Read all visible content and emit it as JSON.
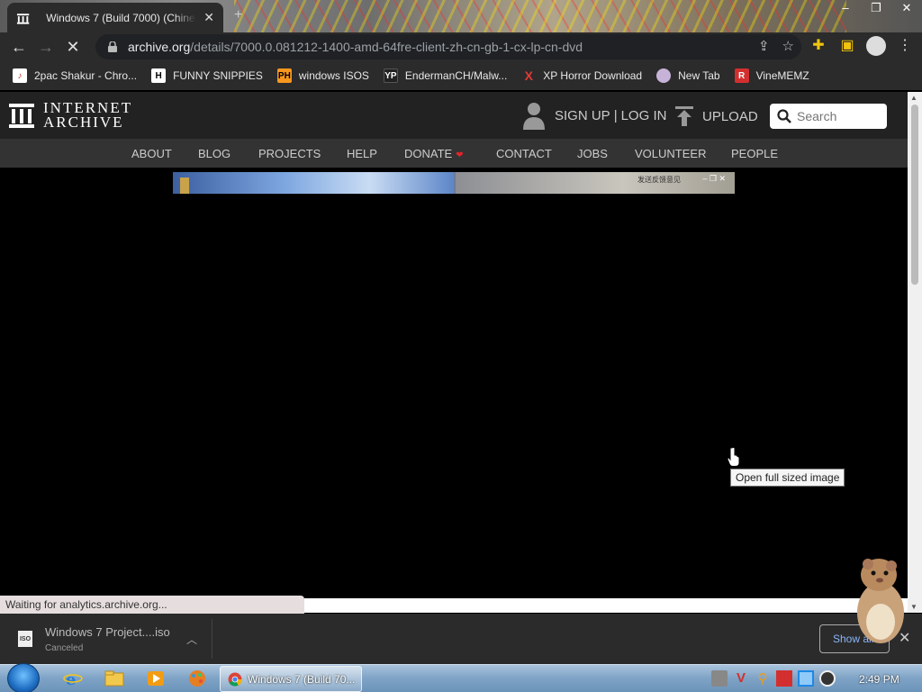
{
  "browser": {
    "tab_title": "Windows 7 (Build 7000) (Chinese",
    "url_host": "archive.org",
    "url_path": "/details/7000.0.081212-1400-amd-64fre-client-zh-cn-gb-1-cx-lp-cn-dvd",
    "status_text": "Waiting for analytics.archive.org..."
  },
  "bookmarks": [
    {
      "label": "2pac Shakur - Chro...",
      "icon": "music-icon",
      "color": "#c0392b"
    },
    {
      "label": "FUNNY SNIPPIES",
      "icon": "h-icon",
      "color": "#ffffff"
    },
    {
      "label": "windows ISOS",
      "icon": "ph-icon",
      "color": "#f7971e"
    },
    {
      "label": "EndermanCH/Malw...",
      "icon": "yp-icon",
      "color": "#222222"
    },
    {
      "label": "XP Horror Download",
      "icon": "x-icon",
      "color": "#e53935"
    },
    {
      "label": "New Tab",
      "icon": "avatar-icon",
      "color": "#c7b3d8"
    },
    {
      "label": "VineMEMZ",
      "icon": "r-icon",
      "color": "#d32f2f"
    }
  ],
  "ia": {
    "logo_line1": "INTERNET",
    "logo_line2": "ARCHIVE",
    "sign_up": "SIGN UP",
    "separator": "|",
    "log_in": "LOG IN",
    "upload": "UPLOAD",
    "search_placeholder": "Search",
    "nav": [
      "ABOUT",
      "BLOG",
      "PROJECTS",
      "HELP",
      "DONATE",
      "CONTACT",
      "JOBS",
      "VOLUNTEER",
      "PEOPLE"
    ],
    "preview_caption": "发送反馈意见"
  },
  "tooltip": "Open full sized image",
  "download": {
    "file_name": "Windows 7 Project....iso",
    "state": "Canceled",
    "file_type": "ISO",
    "show_all": "Show all"
  },
  "taskbar": {
    "active_window": "Windows 7 (Build 70...",
    "time": "2:49 PM"
  },
  "colors": {
    "chrome_dark": "#2b2b2b",
    "ia_header": "#222222",
    "ia_nav": "#333333",
    "donate_heart": "#e0242a",
    "taskbar_blue": "#7ea3c6"
  }
}
